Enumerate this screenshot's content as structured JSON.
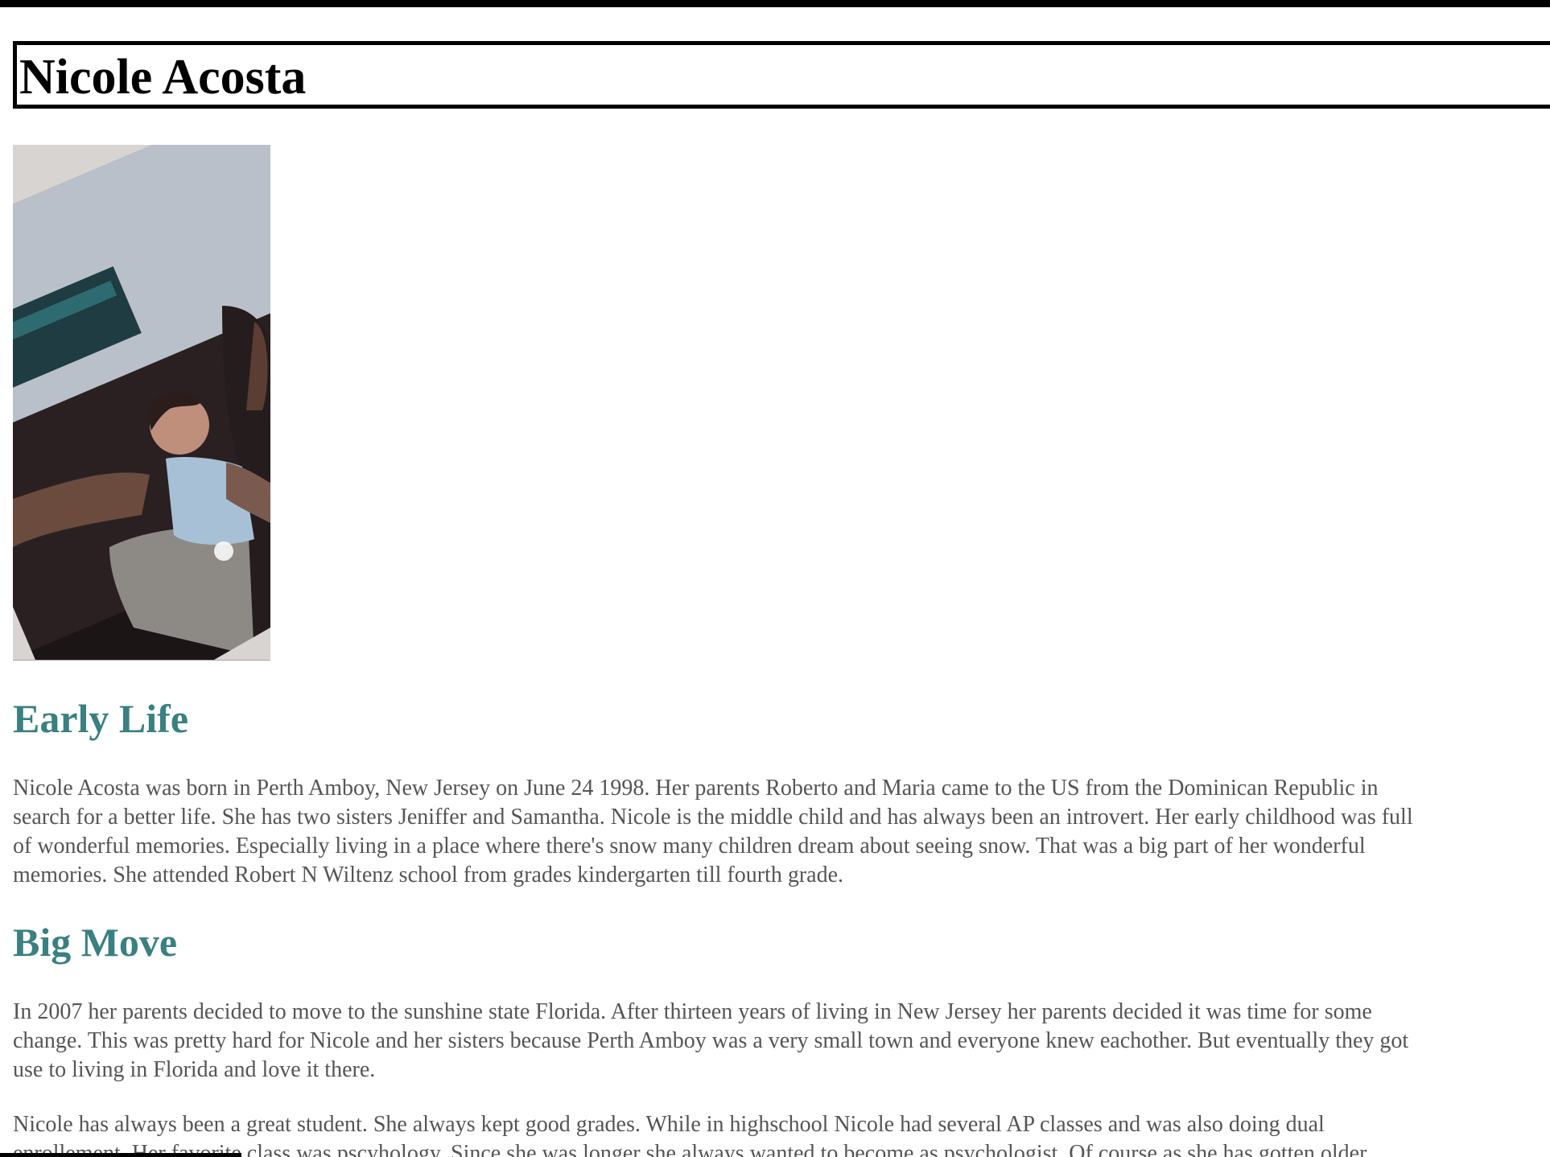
{
  "page": {
    "title": "Nicole Acosta",
    "accent_color": "#3a8080",
    "text_color": "#555555"
  },
  "photo": {
    "alt": "Nicole Acosta as a baby"
  },
  "sections": [
    {
      "heading": "Early Life",
      "lines": [
        "Nicole Acosta was born in Perth Amboy, New Jersey on June 24 1998. Her parents Roberto and Maria came to the US from the Dominican Republic in",
        "search for a better life. She has two sisters Jeniffer and Samantha. Nicole is the middle child and has always been an introvert. Her early childhood was full",
        "of wonderful memories. Especially living in a place where there's snow many children dream about seeing snow. That was a big part of her wonderful",
        "memories. She attended Robert N Wiltenz school from grades kindergarten till fourth grade."
      ]
    },
    {
      "heading": "Big Move",
      "lines": [
        "In 2007 her parents decided to move to the sunshine state Florida. After thirteen years of living in New Jersey her parents decided it was time for some",
        "change. This was pretty hard for Nicole and her sisters because Perth Amboy was a very small town and everyone knew eachother. But eventually they got",
        "use to living in Florida and love it there."
      ],
      "lines2": [
        "Nicole has always been a great student. She always kept good grades. While in highschool Nicole had several AP classes and was also doing dual",
        "enrollement. Her favorite class was pscyhology. Since she was longer she always wanted to become as psychologist. Of course as she has gotten older"
      ]
    }
  ]
}
